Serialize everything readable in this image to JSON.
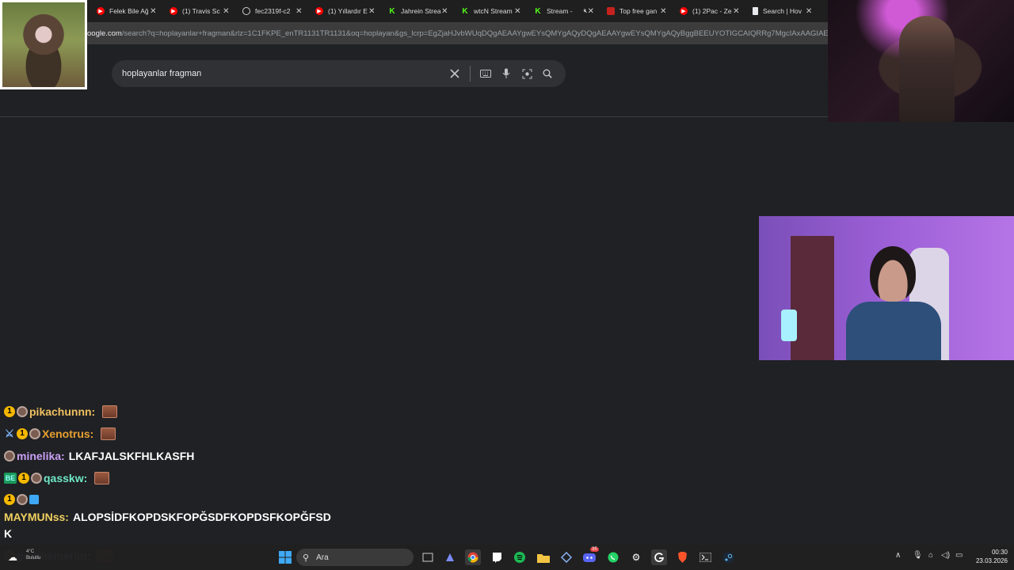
{
  "browser": {
    "tabs": [
      {
        "title": "Felek Bile Ağ",
        "favicon": "youtube-icon",
        "muted": false
      },
      {
        "title": "(1) Travis Sc",
        "favicon": "youtube-icon",
        "muted": false
      },
      {
        "title": "fec2319f-c2",
        "favicon": "globe-icon",
        "muted": false
      },
      {
        "title": "(1) Yıllardır E",
        "favicon": "youtube-icon",
        "muted": false
      },
      {
        "title": "Jahrein Strea",
        "favicon": "kick-icon",
        "muted": false
      },
      {
        "title": "wtcN Stream",
        "favicon": "kick-icon",
        "muted": false
      },
      {
        "title": "Stream - ",
        "favicon": "kick-icon",
        "muted": true
      },
      {
        "title": "Top free gan",
        "favicon": "mail-icon",
        "muted": false
      },
      {
        "title": "(1) 2Pac - Ze",
        "favicon": "youtube-icon",
        "muted": false
      },
      {
        "title": "Search | Hov",
        "favicon": "doc-icon",
        "muted": false
      }
    ],
    "url_host": "oogle.com",
    "url_rest": "/search?q=hoplayanlar+fragman&rlz=1C1FKPE_enTR1131TR1131&oq=hoplayan&gs_lcrp=EgZjaHJvbWUqDQgAEAAYgwEYsQMYgAQyDQgAEAAYgwEYsQMYgAQyBggBEEUYOTIGCAIQRRg7MgcIAxAAGIAEMgcIBBAAGIA"
  },
  "search": {
    "query": "hoplayanlar fragman"
  },
  "chat": [
    {
      "badges": [
        "one",
        "sub"
      ],
      "user": "pikachunnn:",
      "user_color": "#f0c060",
      "text": "",
      "emote": true
    },
    {
      "badges": [
        "sword",
        "one",
        "sub"
      ],
      "user": "Xenotrus:",
      "user_color": "#e8a030",
      "text": "",
      "emote": true
    },
    {
      "badges": [
        "sub"
      ],
      "user": "minelika:",
      "user_color": "#c9a0f5",
      "text": "LKAFJALSKFHLKASFH",
      "emote": false
    },
    {
      "badges": [
        "green",
        "one",
        "sub"
      ],
      "user": "qasskw:",
      "user_color": "#6ee8c8",
      "text": "",
      "emote": true
    },
    {
      "badges": [
        "one",
        "sub",
        "cube"
      ],
      "user": "",
      "user_color": "#f0c060",
      "text": "",
      "emote": false
    },
    {
      "badges": [],
      "user": "MAYMUNss:",
      "user_color": "#f0d060",
      "text": "ALOPSİDFKOPDSKFOPĞSDFKOPDSFKOPĞFSD",
      "emote": false
    },
    {
      "badges": [],
      "user": "",
      "user_color": "#ffffff",
      "text": "K",
      "emote": false
    },
    {
      "badges": [
        "sub"
      ],
      "user": "godthemerlin:",
      "user_color": "#c9a0f5",
      "text": "",
      "emote": true
    }
  ],
  "taskbar": {
    "weather_temp": "4°C",
    "weather_desc": "Bulutlu",
    "search_placeholder": "Ara",
    "time": "00:30",
    "date": "23.03.2026",
    "discord_badge": "35"
  },
  "colors": {
    "page_bg": "#202124",
    "searchbox_bg": "#303134",
    "tab_bg": "#1f1f1f",
    "url_bg": "#3c3c3c"
  }
}
